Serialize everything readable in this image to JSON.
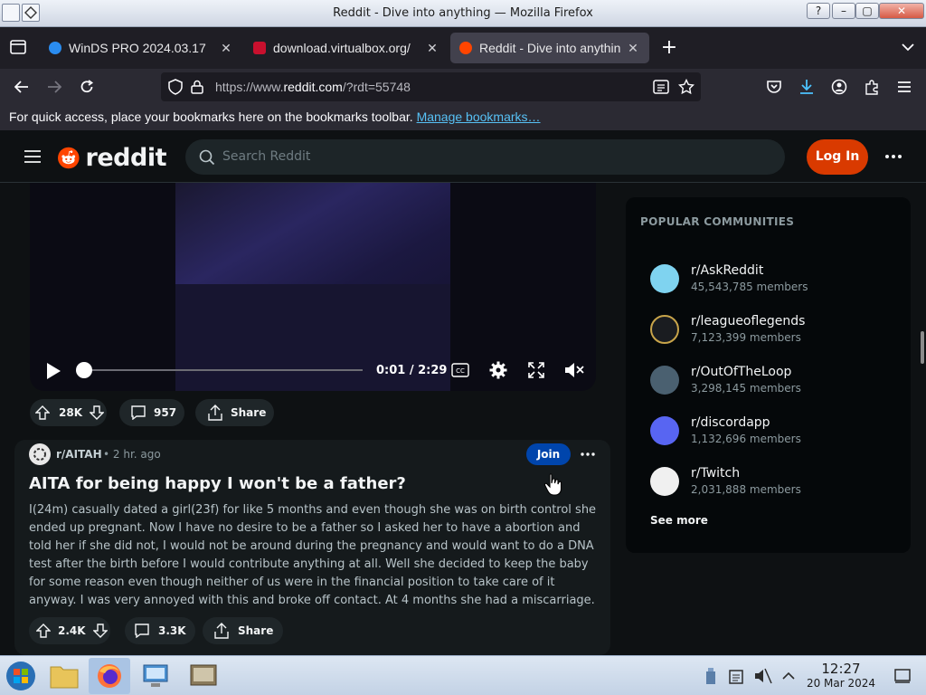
{
  "window": {
    "title": "Reddit - Dive into anything — Mozilla Firefox"
  },
  "tabs": [
    {
      "label": "WinDS PRO 2024.03.17"
    },
    {
      "label": "download.virtualbox.org/"
    },
    {
      "label": "Reddit - Dive into anythin"
    }
  ],
  "nav": {
    "url_prefix": "https://www.",
    "url_domain": "reddit.com",
    "url_suffix": "/?rdt=55748"
  },
  "bookmarks": {
    "text": "For quick access, place your bookmarks here on the bookmarks toolbar.",
    "link": "Manage bookmarks…"
  },
  "reddit": {
    "logo_text": "reddit",
    "search_placeholder": "Search Reddit",
    "login_label": "Log In"
  },
  "video": {
    "time": "0:01 / 2:29",
    "progress_fraction": 0.0
  },
  "post1_actions": {
    "votes": "28K",
    "comments": "957",
    "share": "Share"
  },
  "post2": {
    "subreddit": "r/AITAH",
    "age": "• 2 hr. ago",
    "join": "Join",
    "title": "AITA for being happy I won't be a father?",
    "body": "I(24m) casually dated a girl(23f) for like 5 months and even though she was on birth control she ended up pregnant. Now I have no desire to be a father so I asked her to have a abortion and told her if she did not, I would not be around during the pregnancy and would want to do a DNA test after the birth before I would contribute anything at all. Well she decided to keep the baby for some reason even though neither of us were in the financial position to take care of it anyway. I was very annoyed with this and broke off contact. At 4 months she had a miscarriage. I was informed about it by her…",
    "votes": "2.4K",
    "comments": "3.3K",
    "share": "Share"
  },
  "sidebar": {
    "heading": "POPULAR COMMUNITIES",
    "communities": [
      {
        "name": "r/AskReddit",
        "members": "45,543,785 members",
        "color": "#7fd3f0"
      },
      {
        "name": "r/leagueoflegends",
        "members": "7,123,399 members",
        "color": "#c8a44a"
      },
      {
        "name": "r/OutOfTheLoop",
        "members": "3,298,145 members",
        "color": "#4a6070"
      },
      {
        "name": "r/discordapp",
        "members": "1,132,696 members",
        "color": "#5865f2"
      },
      {
        "name": "r/Twitch",
        "members": "2,031,888 members",
        "color": "#9146ff"
      }
    ],
    "see_more": "See more"
  },
  "taskbar": {
    "time": "12:27",
    "date": "20 Mar 2024"
  }
}
